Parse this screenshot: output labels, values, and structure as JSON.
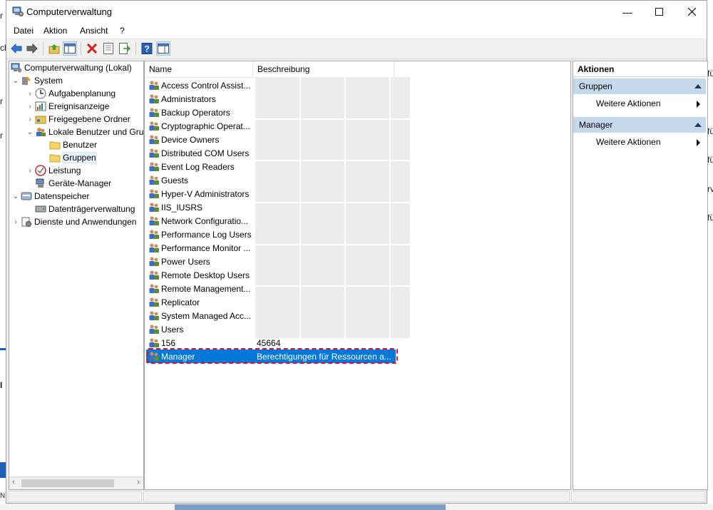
{
  "window": {
    "title": "Computerverwaltung"
  },
  "menubar": [
    {
      "label": "Datei"
    },
    {
      "label": "Aktion"
    },
    {
      "label": "Ansicht"
    },
    {
      "label": "?"
    }
  ],
  "toolbar": {
    "icons": [
      "back-arrow-icon",
      "forward-arrow-icon",
      "up-folder-icon",
      "show-hide-console-tree-icon",
      "delete-icon",
      "properties-icon",
      "export-list-icon",
      "help-icon",
      "show-hide-action-pane-icon"
    ]
  },
  "tree": {
    "root": "Computerverwaltung (Lokal)",
    "system": "System",
    "aufgabenplanung": "Aufgabenplanung",
    "ereignisanzeige": "Ereignisanzeige",
    "freigegebene": "Freigegebene Ordner",
    "lokale": "Lokale Benutzer und Gruppen",
    "benutzer": "Benutzer",
    "gruppen": "Gruppen",
    "leistung": "Leistung",
    "geraete": "Geräte-Manager",
    "datenspeicher": "Datenspeicher",
    "datentraeger": "Datenträgerverwaltung",
    "dienste": "Dienste und Anwendungen"
  },
  "list": {
    "columns": [
      "Name",
      "Beschreibung"
    ],
    "rows": [
      {
        "name": "Access Control Assist...",
        "desc": ""
      },
      {
        "name": "Administrators",
        "desc": ""
      },
      {
        "name": "Backup Operators",
        "desc": ""
      },
      {
        "name": "Cryptographic Operat...",
        "desc": ""
      },
      {
        "name": "Device Owners",
        "desc": ""
      },
      {
        "name": "Distributed COM Users",
        "desc": ""
      },
      {
        "name": "Event Log Readers",
        "desc": ""
      },
      {
        "name": "Guests",
        "desc": ""
      },
      {
        "name": "Hyper-V Administrators",
        "desc": ""
      },
      {
        "name": "IIS_IUSRS",
        "desc": ""
      },
      {
        "name": "Network Configuratio...",
        "desc": ""
      },
      {
        "name": "Performance Log Users",
        "desc": ""
      },
      {
        "name": "Performance Monitor ...",
        "desc": ""
      },
      {
        "name": "Power Users",
        "desc": ""
      },
      {
        "name": "Remote Desktop Users",
        "desc": ""
      },
      {
        "name": "Remote Management...",
        "desc": ""
      },
      {
        "name": "Replicator",
        "desc": ""
      },
      {
        "name": "System Managed Acc...",
        "desc": ""
      },
      {
        "name": "Users",
        "desc": ""
      },
      {
        "name": "156",
        "desc": "45664"
      },
      {
        "name": "Manager",
        "desc": "Berechtigungen für Ressourcen a...",
        "selected": true
      }
    ]
  },
  "actions": {
    "title": "Aktionen",
    "sections": [
      {
        "header": "Gruppen",
        "item": "Weitere Aktionen"
      },
      {
        "header": "Manager",
        "item": "Weitere Aktionen"
      }
    ]
  },
  "background_window": {
    "left_fragments": [
      "r",
      "ch",
      "r",
      "r"
    ],
    "right_fragments": [
      "fü",
      "fü",
      "fü",
      "rv",
      "fü"
    ],
    "bottom_fragments": [
      "I",
      "N"
    ]
  },
  "colors": {
    "selection": "#0078d7",
    "action_header": "#c5d9ed",
    "highlight_outline": "#e0102a"
  }
}
